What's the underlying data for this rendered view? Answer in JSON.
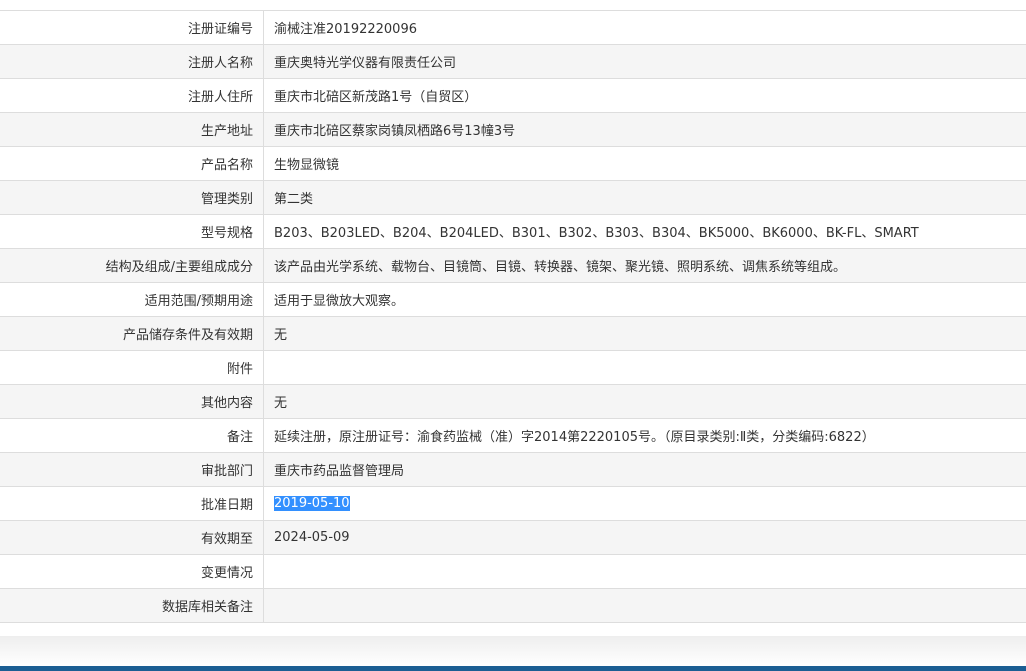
{
  "rows": [
    {
      "label": "注册证编号",
      "value": "渝械注准20192220096"
    },
    {
      "label": "注册人名称",
      "value": "重庆奥特光学仪器有限责任公司"
    },
    {
      "label": "注册人住所",
      "value": "重庆市北碚区新茂路1号（自贸区）"
    },
    {
      "label": "生产地址",
      "value": "重庆市北碚区蔡家岗镇凤栖路6号13幢3号"
    },
    {
      "label": "产品名称",
      "value": "生物显微镜"
    },
    {
      "label": "管理类别",
      "value": "第二类"
    },
    {
      "label": "型号规格",
      "value": "B203、B203LED、B204、B204LED、B301、B302、B303、B304、BK5000、BK6000、BK-FL、SMART"
    },
    {
      "label": "结构及组成/主要组成成分",
      "value": "该产品由光学系统、载物台、目镜筒、目镜、转换器、镜架、聚光镜、照明系统、调焦系统等组成。"
    },
    {
      "label": "适用范围/预期用途",
      "value": "适用于显微放大观察。"
    },
    {
      "label": "产品储存条件及有效期",
      "value": "无"
    },
    {
      "label": "附件",
      "value": ""
    },
    {
      "label": "其他内容",
      "value": "无"
    },
    {
      "label": "备注",
      "value": "延续注册，原注册证号：渝食药监械（准）字2014第2220105号。（原目录类别:Ⅱ类，分类编码:6822）"
    },
    {
      "label": "审批部门",
      "value": "重庆市药品监督管理局"
    },
    {
      "label": "批准日期",
      "value": "2019-05-10"
    },
    {
      "label": "有效期至",
      "value": "2024-05-09"
    },
    {
      "label": "变更情况",
      "value": ""
    },
    {
      "label": "数据库相关备注",
      "value": ""
    }
  ],
  "selected_row": 14
}
